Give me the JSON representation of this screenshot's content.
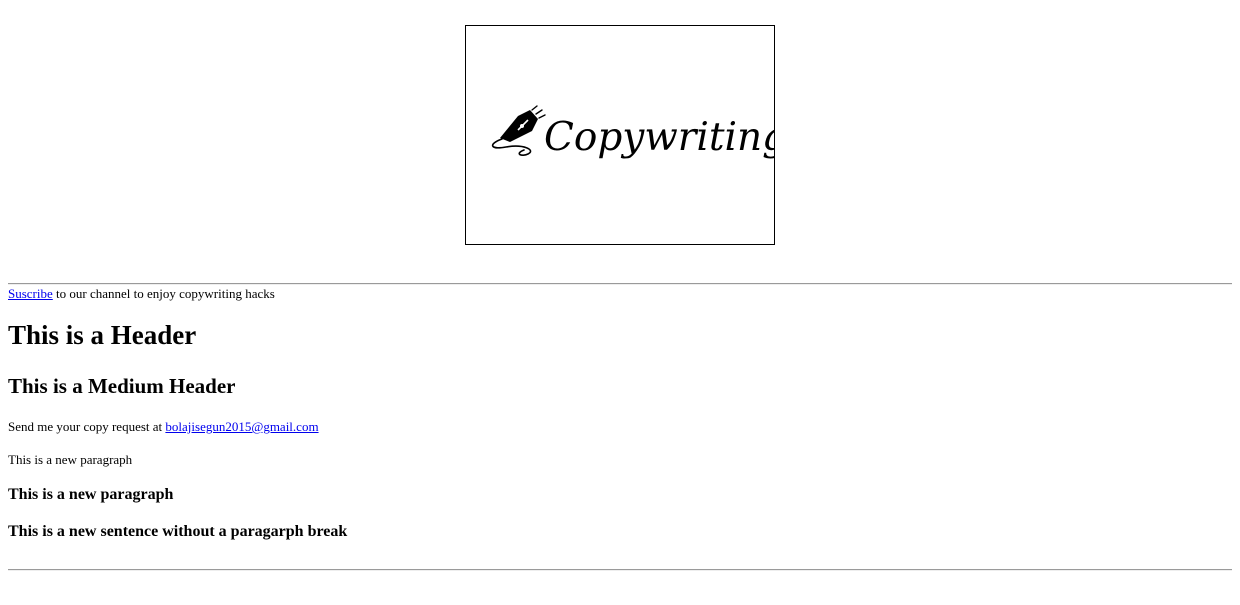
{
  "logo": {
    "text": "Copywriting",
    "icon": "fountain-pen-nib-icon"
  },
  "subscribe": {
    "link_text": "Suscribe",
    "rest_text": " to our channel to enjoy copywriting hacks"
  },
  "headers": {
    "main": "This is a Header",
    "medium": "This is a Medium Header"
  },
  "contact": {
    "prefix": "Send me your copy request at ",
    "email": "bolajisegun2015@gmail.com"
  },
  "paragraphs": {
    "plain": "This is a new paragraph",
    "bold": "This is a new paragraph",
    "sentence": "This is a new sentence without a paragarph break"
  },
  "colors": {
    "link": "#0000ee",
    "text": "#000000",
    "rule": "#9a9a9a"
  }
}
